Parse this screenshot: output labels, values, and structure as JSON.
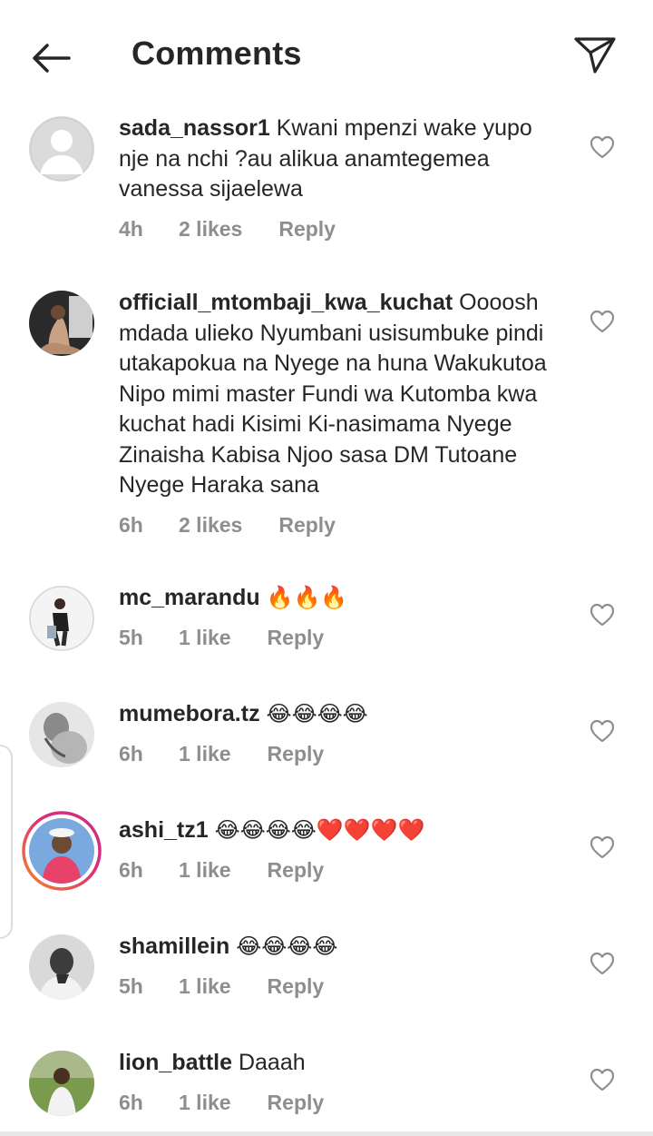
{
  "header": {
    "title": "Comments",
    "back_icon": "arrow-left-icon",
    "send_icon": "paper-plane-icon"
  },
  "comments": [
    {
      "username": "sada_nassor1",
      "text": "Kwani mpenzi wake yupo nje na nchi ?au alikua anamtegemea vanessa sijaelewa",
      "time": "4h",
      "likes": "2 likes",
      "reply": "Reply",
      "avatar": "default-avatar"
    },
    {
      "username": "officiall_mtombaji_kwa_kuchat",
      "text": "Oooosh mdada ulieko Nyumbani usisumbuke pindi utakapokua na Nyege na huna Wakukutoa Nipo mimi master Fundi wa Kutomba kwa kuchat hadi Kisimi Ki-nasimama Nyege Zinaisha Kabisa Njoo sasa DM Tutoane Nyege Haraka sana",
      "time": "6h",
      "likes": "2 likes",
      "reply": "Reply",
      "avatar": "photo-avatar"
    },
    {
      "username": "mc_marandu",
      "text": "🔥🔥🔥",
      "time": "5h",
      "likes": "1 like",
      "reply": "Reply",
      "avatar": "photo-avatar"
    },
    {
      "username": "mumebora.tz",
      "text": "😂😂😂😂",
      "time": "6h",
      "likes": "1 like",
      "reply": "Reply",
      "avatar": "photo-avatar"
    },
    {
      "username": "ashi_tz1",
      "text": "😂😂😂😂❤️❤️❤️❤️",
      "time": "6h",
      "likes": "1 like",
      "reply": "Reply",
      "avatar": "story-avatar"
    },
    {
      "username": "shamillein",
      "text": "😂😂😂😂",
      "time": "5h",
      "likes": "1 like",
      "reply": "Reply",
      "avatar": "photo-avatar"
    },
    {
      "username": "lion_battle",
      "text": "Daaah",
      "time": "6h",
      "likes": "1 like",
      "reply": "Reply",
      "avatar": "photo-avatar"
    }
  ],
  "colors": {
    "text": "#262626",
    "secondary": "#8e8e8e",
    "story_ring_start": "#f58529",
    "story_ring_end": "#dd2a7b"
  }
}
